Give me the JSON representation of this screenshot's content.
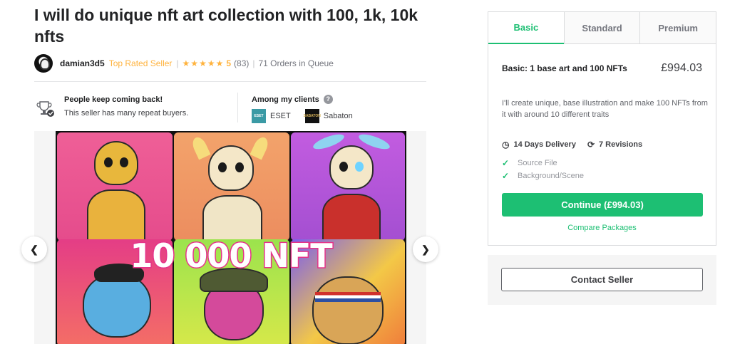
{
  "gig": {
    "title": "I will do unique nft art collection with 100, 1k, 10k nfts"
  },
  "seller": {
    "name": "damian3d5",
    "level": "Top Rated Seller",
    "stars": "★★★★★",
    "rating": "5",
    "review_count": "(83)",
    "orders_in_queue": "71 Orders in Queue"
  },
  "highlight": {
    "title": "People keep coming back!",
    "text": "This seller has many repeat buyers."
  },
  "clients": {
    "title": "Among my clients",
    "help_glyph": "?",
    "items": [
      {
        "name": "ESET",
        "logo": "ESET"
      },
      {
        "name": "Sabaton",
        "logo": "SABATON"
      }
    ]
  },
  "gallery": {
    "overlay_text": "10 000 NFT",
    "prev_glyph": "❮",
    "next_glyph": "❯"
  },
  "package": {
    "tabs": [
      "Basic",
      "Standard",
      "Premium"
    ],
    "active_tab": "Basic",
    "name": "Basic: 1 base art and 100 NFTs",
    "price": "£994.03",
    "description": "I'll create unique, base illustration and make 100 NFTs from it with around 10 different traits",
    "delivery": "14 Days Delivery",
    "revisions": "7 Revisions",
    "features": [
      "Source File",
      "Background/Scene"
    ],
    "continue_label": "Continue (£994.03)",
    "compare_label": "Compare Packages"
  },
  "contact": {
    "label": "Contact Seller"
  },
  "colors": {
    "accent": "#1dbf73",
    "rating": "#ffb33e",
    "text": "#404145"
  },
  "icons": {
    "clock": "clock-icon",
    "revisions": "refresh-icon",
    "check": "check-icon",
    "trophy": "trophy-icon",
    "help": "question-icon",
    "prev": "chevron-left-icon",
    "next": "chevron-right-icon"
  }
}
